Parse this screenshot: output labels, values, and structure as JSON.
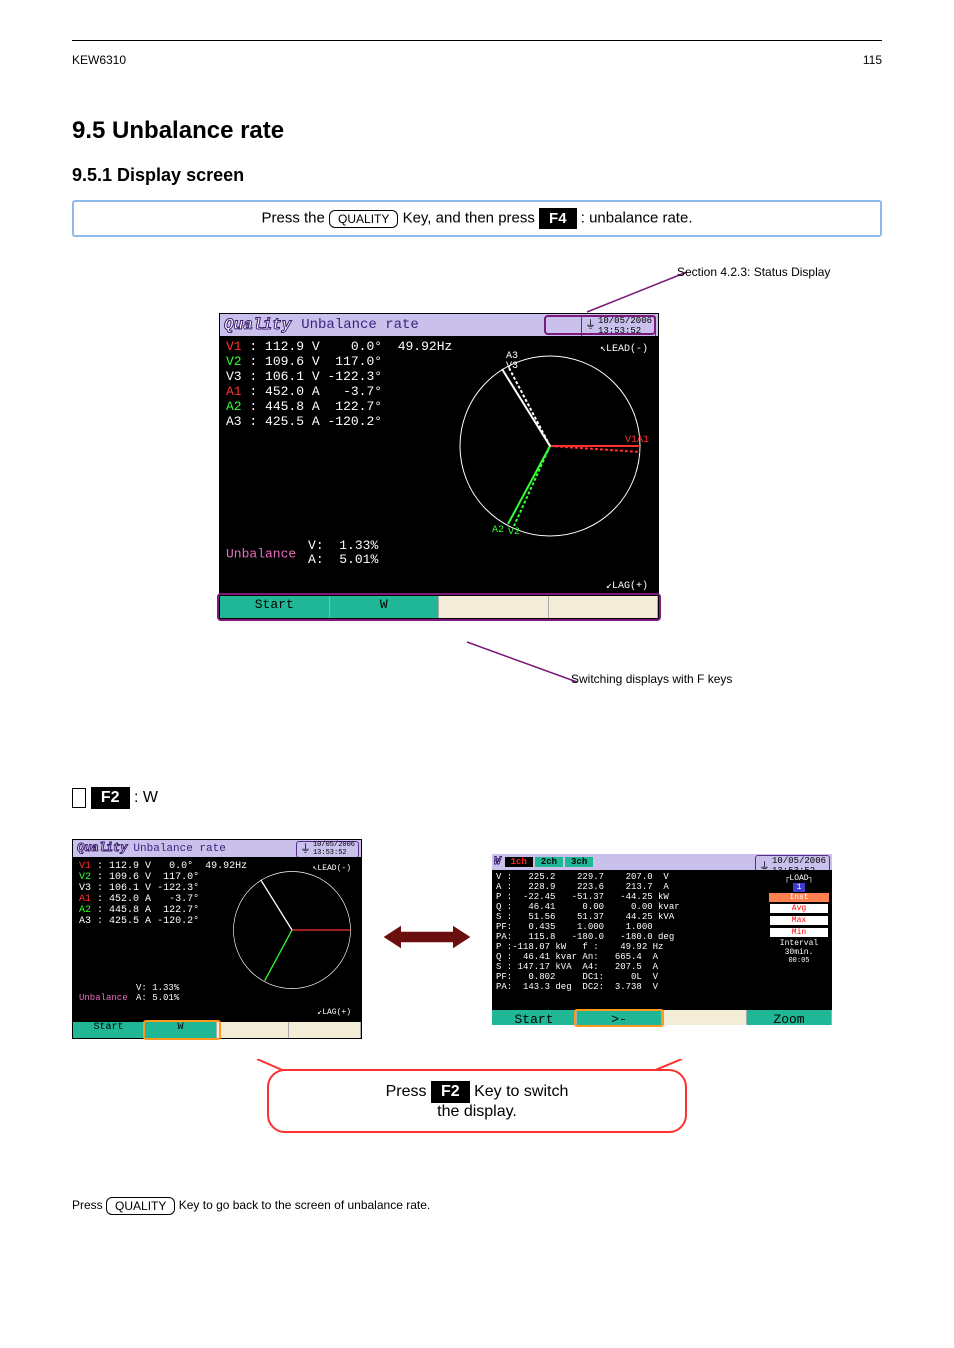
{
  "header_text": "KEW6310",
  "page_num": "115",
  "section_number": "9.5",
  "section_title": "Unbalance rate",
  "subsection": "9.5.1 Display screen",
  "press": {
    "prefix": "Press the ",
    "btn_quality": "QUALITY",
    "mid": " Key, and then press ",
    "btn_f4": "F4",
    "suffix": ": unbalance rate."
  },
  "annot_status": "Section 4.2.3: Status Display",
  "annot_fkey_switch": "Switching displays with F keys",
  "titlebar": {
    "logo": "Quality",
    "title": "Unbalance rate",
    "date": "10/05/2006",
    "time": "13:53:52"
  },
  "measurements": {
    "V1": {
      "label": "V1",
      "value": "112.9",
      "unit": "V",
      "phase": "0.0°",
      "freq": "49.92Hz"
    },
    "V2": {
      "label": "V2",
      "value": "109.6",
      "unit": "V",
      "phase": "117.0°"
    },
    "V3": {
      "label": "V3",
      "value": "106.1",
      "unit": "V",
      "phase": "-122.3°"
    },
    "A1": {
      "label": "A1",
      "value": "452.0",
      "unit": "A",
      "phase": "-3.7°"
    },
    "A2": {
      "label": "A2",
      "value": "445.8",
      "unit": "A",
      "phase": "122.7°"
    },
    "A3": {
      "label": "A3",
      "value": "425.5",
      "unit": "A",
      "phase": "-120.2°"
    }
  },
  "unbalance": {
    "label": "Unbalance",
    "v_label": "V:",
    "v_val": "1.33%",
    "a_label": "A:",
    "a_val": "5.01%"
  },
  "leadlag": {
    "lead": "LEAD(-)",
    "lag": "LAG(+)"
  },
  "fbar": {
    "start": "Start",
    "w": "W",
    "vector": ">-",
    "zoom": "Zoom"
  },
  "f2": {
    "heading_prefix": "F2",
    "heading_text": ": W",
    "w_logo": "W",
    "tabs": {
      "t1": "1ch",
      "t2": "2ch",
      "t3": "3ch"
    },
    "date": "10/05/2006",
    "time": "13:53:52",
    "rows": [
      "V :   225.2    229.7    207.0  V",
      "A :   228.9    223.6    213.7  A",
      "P :  -22.45   -51.37   -44.25 kW",
      "Q :   46.41     0.00     0.00 kvar",
      "S :   51.56    51.37    44.25 kVA",
      "PF:   0.435    1.000    1.000",
      "PA:   115.8   -180.0   -180.0 deg",
      "P :-118.07 kW   f :    49.92 Hz",
      "Q :  46.41 kvar An:   665.4  A",
      "S : 147.17 kVA  A4:   207.5  A",
      "PF:   0.802     DC1:     0L  V",
      "PA:  143.3 deg  DC2:  3.738  V"
    ],
    "side": {
      "load": "LOAD",
      "num": "1",
      "inst": "Inst",
      "avg": "Avg",
      "max": "Max",
      "min": "Min",
      "interval": "Interval",
      "intval": "30min.",
      "t": "00:05"
    }
  },
  "callout": {
    "line1_prefix": "Press ",
    "line1_btn": "F2",
    "line1_suffix": " Key to switch",
    "line2": "the display."
  },
  "footnote": {
    "prefix": "Press ",
    "btn": "QUALITY",
    "suffix": " Key to go back to the screen of unbalance rate."
  }
}
